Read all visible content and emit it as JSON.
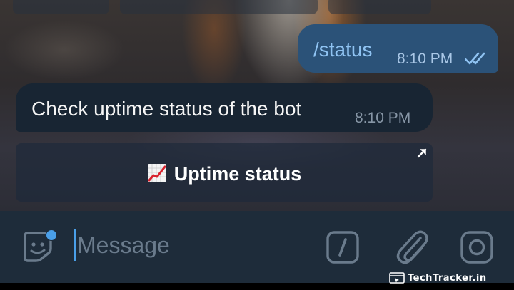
{
  "messages": {
    "outgoing": {
      "text": "/status",
      "time": "8:10 PM",
      "status_icon": "double-check-icon"
    },
    "incoming": {
      "text": "Check uptime status of the bot",
      "time": "8:10 PM"
    }
  },
  "inline_button": {
    "emoji_icon": "chart-increasing-icon",
    "label": "Uptime status",
    "corner_icon": "external-arrow-icon"
  },
  "composer": {
    "placeholder": "Message",
    "value": "",
    "icons": [
      "sticker-icon",
      "bot-commands-icon",
      "attach-icon",
      "camera-icon"
    ]
  },
  "watermark": {
    "text": "TechTracker.in"
  },
  "colors": {
    "outgoing_bubble": "#2b5278",
    "incoming_bubble": "#182533",
    "accent": "#4a9fe8",
    "composer_bg": "#1e2c3a",
    "icon_gray": "#6a7b8c"
  }
}
